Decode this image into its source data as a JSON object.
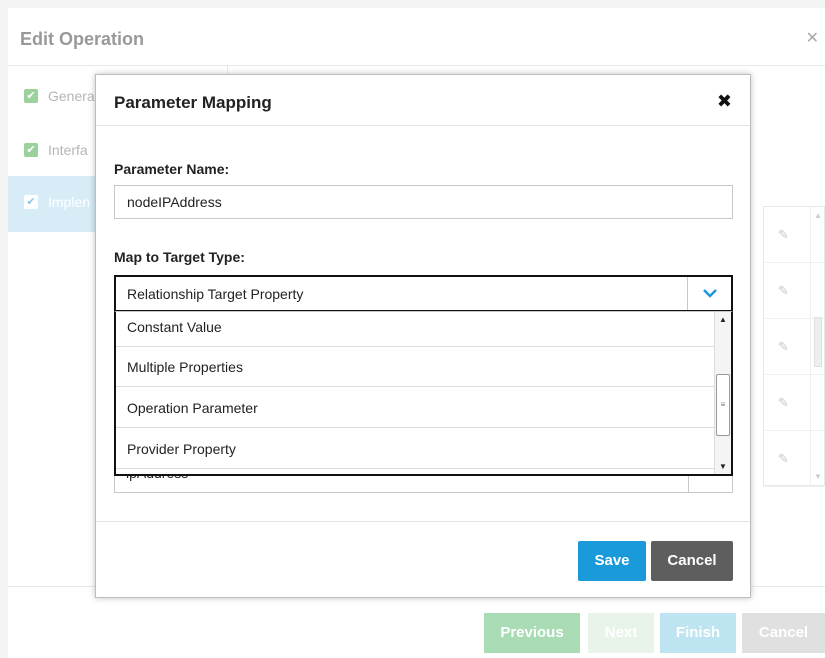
{
  "wizard": {
    "title": "Edit Operation",
    "close": "✕",
    "steps": [
      {
        "label": "Genera"
      },
      {
        "label": "Interfa"
      },
      {
        "label": "Implen"
      }
    ],
    "footer": {
      "previous": "Previous",
      "next": "Next",
      "finish": "Finish",
      "cancel": "Cancel"
    }
  },
  "modal": {
    "title": "Parameter Mapping",
    "close": "✖",
    "parameter_name_label": "Parameter Name:",
    "parameter_name_value": "nodeIPAddress",
    "map_to_target_type_label": "Map to Target Type:",
    "selected_type": "Relationship Target Property",
    "options": [
      "Constant Value",
      "Multiple Properties",
      "Operation Parameter",
      "Provider Property"
    ],
    "hidden_field_value": "ipAddress",
    "save": "Save",
    "cancel": "Cancel"
  },
  "colors": {
    "primary": "#1a9ad8",
    "secondary": "#5e5e5e",
    "success": "#a9dbb5",
    "check": "#9bd19c",
    "active_step_bg": "#d7ecf7"
  }
}
